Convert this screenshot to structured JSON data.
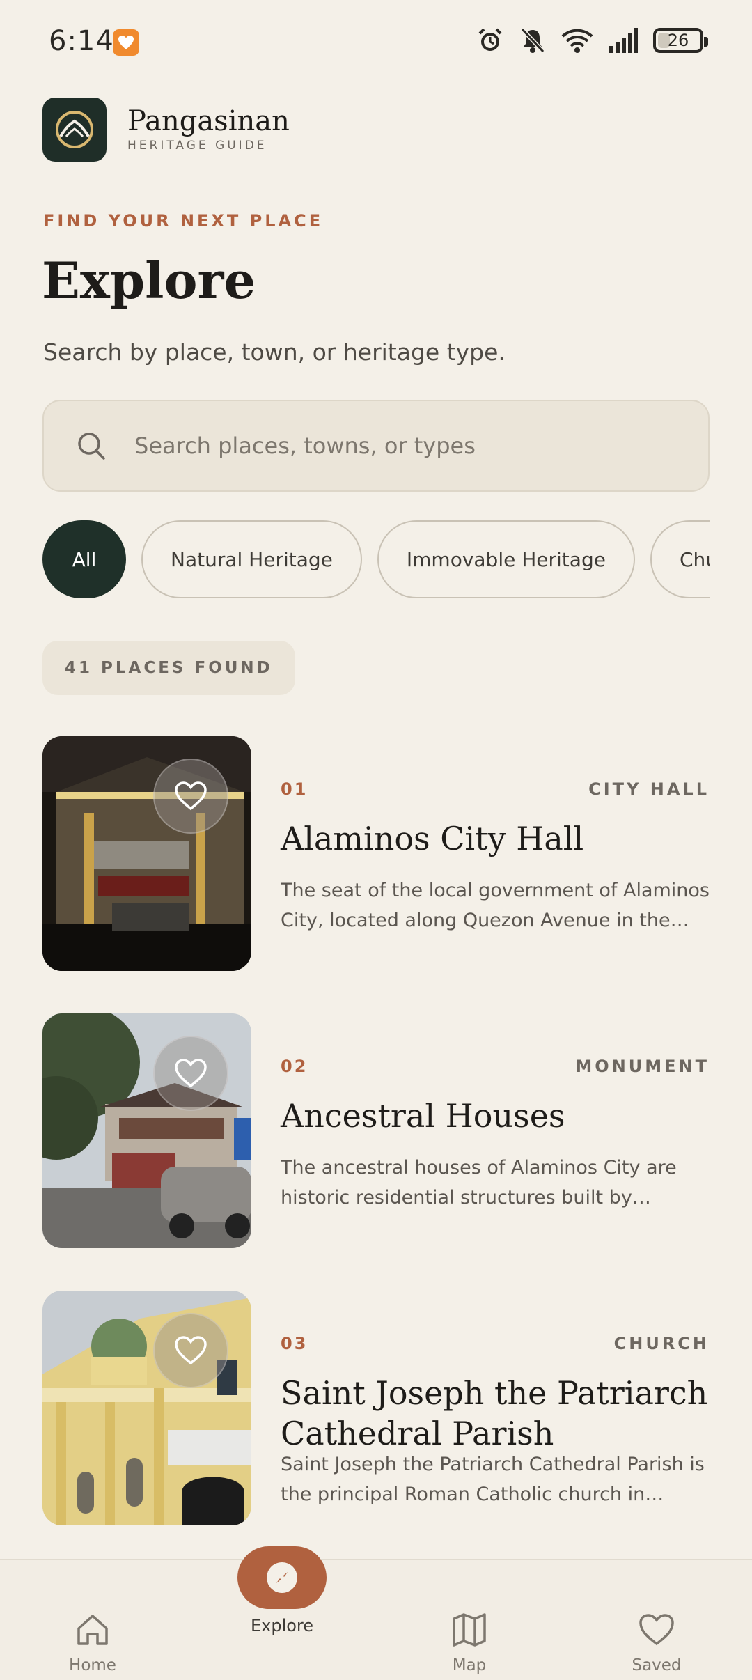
{
  "status_bar": {
    "time": "6:14",
    "battery": "26"
  },
  "brand": {
    "name": "Pangasinan",
    "subtitle": "HERITAGE GUIDE"
  },
  "header": {
    "eyebrow": "FIND YOUR NEXT PLACE",
    "title": "Explore",
    "subtitle": "Search by place, town, or heritage type."
  },
  "search": {
    "placeholder": "Search places, towns, or types",
    "value": ""
  },
  "filters": [
    {
      "label": "All",
      "active": true
    },
    {
      "label": "Natural Heritage",
      "active": false
    },
    {
      "label": "Immovable Heritage",
      "active": false
    },
    {
      "label": "Churc",
      "active": false
    }
  ],
  "results": {
    "count_label": "41 PLACES FOUND"
  },
  "places": [
    {
      "number": "01",
      "type": "CITY HALL",
      "title": "Alaminos City Hall",
      "description": "The seat of the local government of Alaminos City, located along Quezon Avenue in the city ..."
    },
    {
      "number": "02",
      "type": "MONUMENT",
      "title": "Ancestral Houses",
      "description": "The ancestral houses of Alaminos City are historic residential structures built by promine..."
    },
    {
      "number": "03",
      "type": "CHURCH",
      "title": "Saint Joseph the Patriarch Cathedral Parish",
      "description": "Saint Joseph the Patriarch Cathedral Parish is the principal Roman Catholic church in Alamin..."
    }
  ],
  "bottom_nav": {
    "home": "Home",
    "explore": "Explore",
    "map": "Map",
    "saved": "Saved"
  },
  "colors": {
    "background": "#f4f0e8",
    "accent": "#b0613f",
    "dark_green": "#1f3029"
  }
}
